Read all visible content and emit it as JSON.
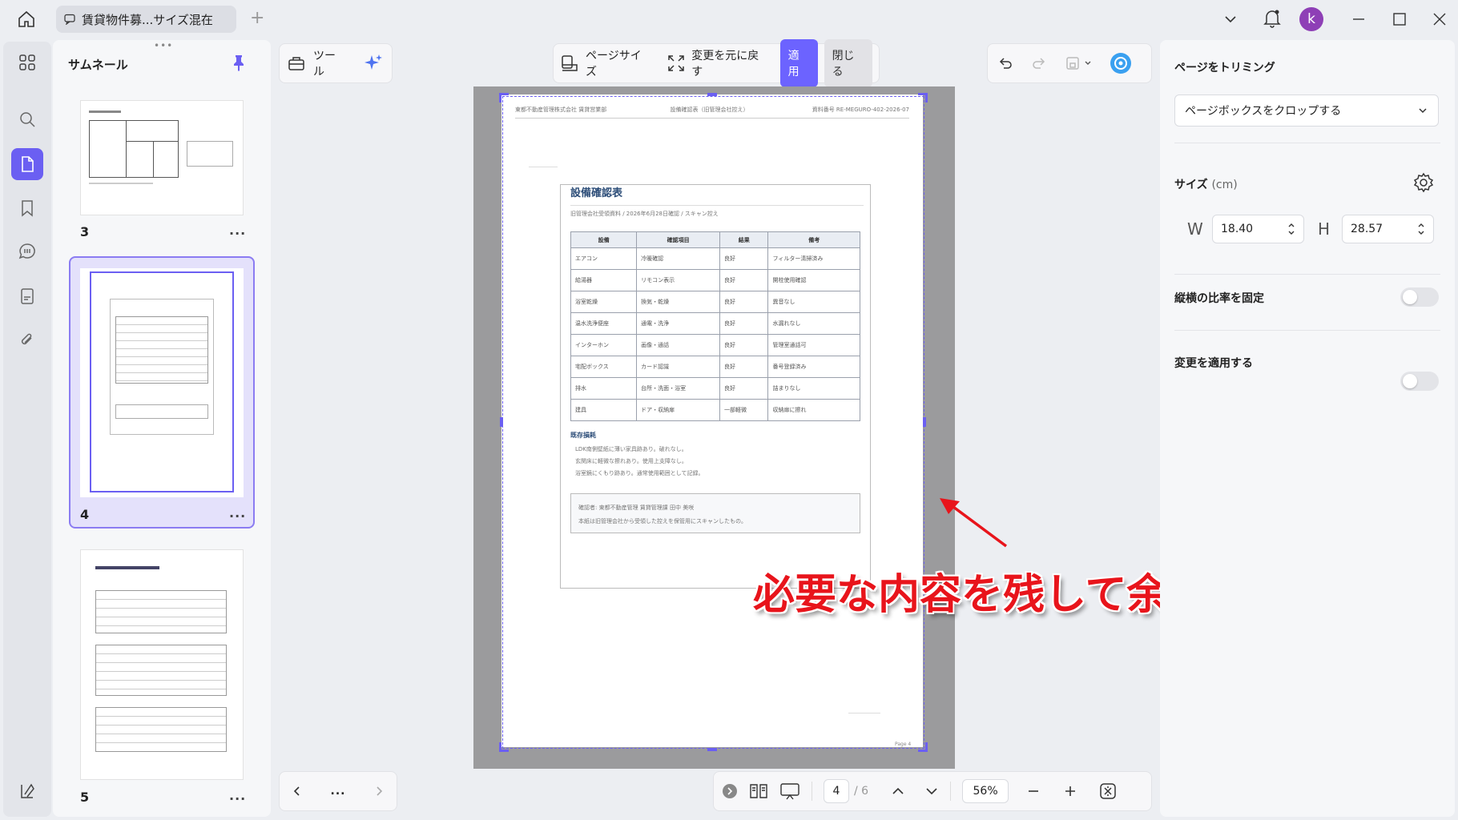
{
  "tab": {
    "title": "賃貸物件募...サイズ混在",
    "add_label": "+"
  },
  "user": {
    "avatar_letter": "k"
  },
  "thumbnails": {
    "title": "サムネール",
    "pages": [
      {
        "number": "3",
        "menu": "..."
      },
      {
        "number": "4",
        "menu": "..."
      },
      {
        "number": "5",
        "menu": "..."
      }
    ]
  },
  "toolbar": {
    "tools_label": "ツール",
    "page_size_label": "ページサイズ",
    "revert_label": "変更を元に戻す",
    "apply_label": "適用",
    "close_label": "閉じる"
  },
  "document": {
    "header_left": "東都不動産管理株式会社 賃貸営業部",
    "header_center": "設備確認表（旧管理会社控え）",
    "header_right": "資料番号 RE-MEGURO-402-2026-07",
    "title": "設備確認表",
    "subtitle": "旧管理会社受領資料 / 2026年6月28日確認 / スキャン控え",
    "table_headers": [
      "設備",
      "確認項目",
      "結果",
      "備考"
    ],
    "table_rows": [
      [
        "エアコン",
        "冷暖確認",
        "良好",
        "フィルター清掃済み"
      ],
      [
        "給湯器",
        "リモコン表示",
        "良好",
        "開栓使用確認"
      ],
      [
        "浴室乾燥",
        "換気・乾燥",
        "良好",
        "異音なし"
      ],
      [
        "温水洗浄便座",
        "通電・洗浄",
        "良好",
        "水漏れなし"
      ],
      [
        "インターホン",
        "画像・通話",
        "良好",
        "管理室通話可"
      ],
      [
        "宅配ボックス",
        "カード認識",
        "良好",
        "番号登録済み"
      ],
      [
        "排水",
        "台所・洗面・浴室",
        "良好",
        "詰まりなし"
      ],
      [
        "建具",
        "ドア・収納扉",
        "一部軽微",
        "収納扉に擦れ"
      ]
    ],
    "section_title": "既存損耗",
    "notes": [
      "LDK南側壁紙に薄い家具跡あり。破れなし。",
      "玄関床に軽微な擦れあり。使用上支障なし。",
      "浴室鏡にくもり跡あり。通常使用範囲として記録。"
    ],
    "confirm_line1": "確認者: 東都不動産管理 賃貸管理課 田中 美咲",
    "confirm_line2": "本紙は旧管理会社から受領した控えを保管用にスキャンしたもの。",
    "page_footer": "Page 4"
  },
  "annotation": {
    "text": "必要な内容を残して余白を調整"
  },
  "right_panel": {
    "title": "ページをトリミング",
    "dropdown_value": "ページボックスをクロップする",
    "size_label": "サイズ",
    "size_unit": "(cm)",
    "w_label": "W",
    "w_value": "18.40",
    "h_label": "H",
    "h_value": "28.57",
    "lock_ratio_label": "縦横の比率を固定",
    "apply_changes_label": "変更を適用する"
  },
  "bottom": {
    "current_page": "4",
    "total_pages": "/ 6",
    "zoom": "56%",
    "nav_more": "..."
  },
  "colors": {
    "accent": "#6c63ff",
    "annotation": "#e8141b",
    "avatar": "#8e3fb6"
  }
}
